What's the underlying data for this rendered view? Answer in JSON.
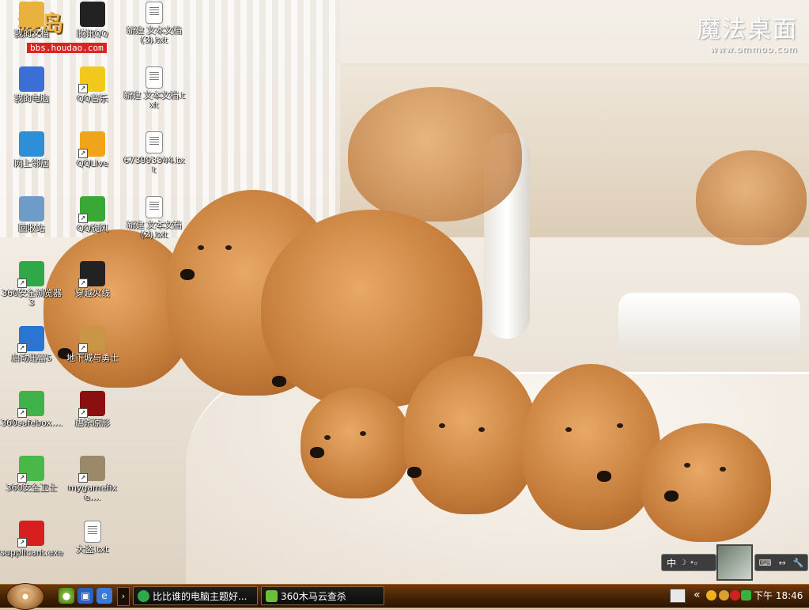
{
  "watermarks": {
    "forum_logo_text": "猴岛",
    "forum_url": "bbs.houdao.com",
    "brand_title": "魔法桌面",
    "brand_url": "www.ommoo.com"
  },
  "desktop_icons": [
    {
      "label": "我的文档",
      "icon": "folder-icon",
      "color": "#e9b13e"
    },
    {
      "label": "腾讯QQ",
      "icon": "qq-penguin-icon",
      "color": "#222222"
    },
    {
      "label": "新建 文本文档 (3).txt",
      "icon": "text-file-icon",
      "color": "#ffffff"
    },
    {
      "label": "我的电脑",
      "icon": "computer-icon",
      "color": "#3b6fd6"
    },
    {
      "label": "QQ音乐",
      "icon": "qq-music-icon",
      "color": "#f2c81c"
    },
    {
      "label": "新建 文本文档.txt",
      "icon": "text-file-icon",
      "color": "#ffffff"
    },
    {
      "label": "网上邻居",
      "icon": "network-globe-icon",
      "color": "#2c8fd8"
    },
    {
      "label": "QQLive",
      "icon": "qqlive-play-icon",
      "color": "#f0a419"
    },
    {
      "label": "673993344.txt",
      "icon": "text-file-icon",
      "color": "#ffffff"
    },
    {
      "label": "回收站",
      "icon": "recycle-bin-icon",
      "color": "#6f9bc8"
    },
    {
      "label": "QQ旋风",
      "icon": "qq-whirlwind-icon",
      "color": "#39a834"
    },
    {
      "label": "新建 文本文档 (2).txt",
      "icon": "text-file-icon",
      "color": "#ffffff"
    },
    {
      "label": "360安全浏览器 3",
      "icon": "browser-360-icon",
      "color": "#2fa84a"
    },
    {
      "label": "穿越火线",
      "icon": "crossfire-icon",
      "color": "#222222"
    },
    {
      "label": "启动迅雷5",
      "icon": "thunder-icon",
      "color": "#2a74d2"
    },
    {
      "label": "地下城与勇士",
      "icon": "dnf-icon",
      "color": "#c89646"
    },
    {
      "label": "360safebox....",
      "icon": "safebox-icon",
      "color": "#3fb34a"
    },
    {
      "label": "虐杀原形",
      "icon": "prototype-game-icon",
      "color": "#8a1010"
    },
    {
      "label": "360安全卫士",
      "icon": "shield-360-icon",
      "color": "#48b848"
    },
    {
      "label": "mygamefixe....",
      "icon": "crossed-swords-icon",
      "color": "#9a8a6a"
    },
    {
      "label": "supplicant.exe",
      "icon": "butterfly-icon",
      "color": "#d81e1e"
    },
    {
      "label": "大盗.txt",
      "icon": "text-file-icon",
      "color": "#ffffff"
    }
  ],
  "language_bar": {
    "ime_label": "中",
    "moon": "☽",
    "dots": "•₀",
    "right_icons": [
      "⌨",
      "↔",
      "🔧"
    ]
  },
  "taskbar": {
    "tasks": [
      {
        "label": "比比谁的电脑主题好...",
        "icon": "browser-360-icon",
        "color": "#2fa84a"
      },
      {
        "label": "360木马云查杀",
        "icon": "shield-360-icon",
        "color": "#6cbf3a"
      }
    ],
    "more_arrow": "›",
    "clock": "下午 18:46"
  }
}
